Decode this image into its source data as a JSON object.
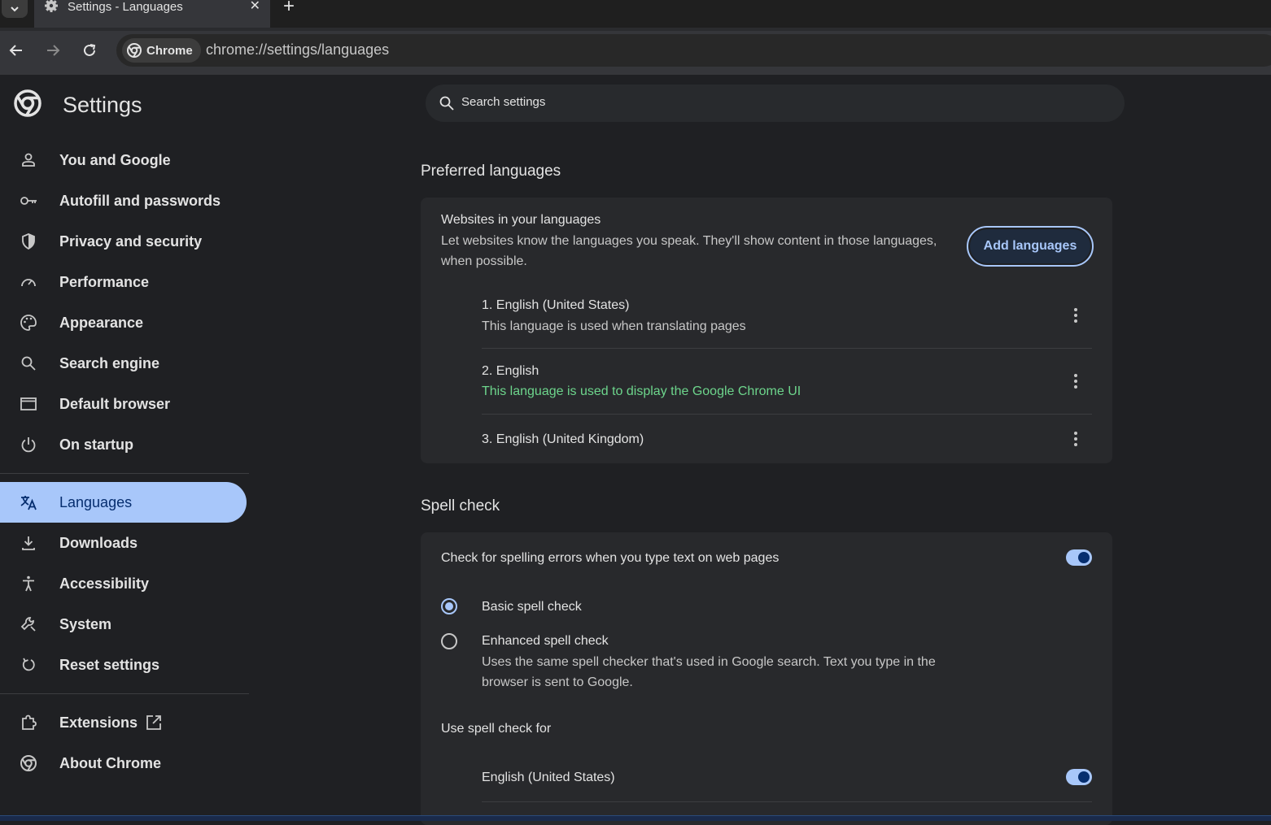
{
  "tab": {
    "title": "Settings - Languages",
    "close": "✕",
    "new_tab": "+"
  },
  "toolbar": {
    "chip_label": "Chrome",
    "url": "chrome://settings/languages"
  },
  "sidebar": {
    "title": "Settings",
    "items": [
      {
        "label": "You and Google",
        "icon": "person-icon"
      },
      {
        "label": "Autofill and passwords",
        "icon": "key-icon"
      },
      {
        "label": "Privacy and security",
        "icon": "shield-icon"
      },
      {
        "label": "Performance",
        "icon": "speedometer-icon"
      },
      {
        "label": "Appearance",
        "icon": "palette-icon"
      },
      {
        "label": "Search engine",
        "icon": "search-icon"
      },
      {
        "label": "Default browser",
        "icon": "browser-window-icon"
      },
      {
        "label": "On startup",
        "icon": "power-icon"
      },
      {
        "label": "Languages",
        "icon": "translate-icon",
        "active": true
      },
      {
        "label": "Downloads",
        "icon": "download-icon"
      },
      {
        "label": "Accessibility",
        "icon": "accessibility-icon"
      },
      {
        "label": "System",
        "icon": "wrench-icon"
      },
      {
        "label": "Reset settings",
        "icon": "reset-icon"
      },
      {
        "label": "Extensions",
        "icon": "puzzle-icon"
      },
      {
        "label": "About Chrome",
        "icon": "chrome-icon"
      }
    ]
  },
  "search": {
    "placeholder": "Search settings"
  },
  "preferred": {
    "section_title": "Preferred languages",
    "heading": "Websites in your languages",
    "description_line1": "Let websites know the languages you speak. They'll show content in those languages,",
    "description_line2": "when possible.",
    "add_button": "Add languages",
    "languages": [
      {
        "name": "1. English (United States)",
        "note": "This language is used when translating pages"
      },
      {
        "name": "2. English",
        "note": "This language is used to display the Google Chrome UI"
      },
      {
        "name": "3. English (United Kingdom)",
        "note": ""
      }
    ]
  },
  "spell": {
    "section_title": "Spell check",
    "toggle_label": "Check for spelling errors when you type text on web pages",
    "toggle_on": true,
    "basic_label": "Basic spell check",
    "enhanced_label": "Enhanced spell check",
    "enhanced_desc_line1": "Uses the same spell checker that's used in Google search. Text you type in the",
    "enhanced_desc_line2": "browser is sent to Google.",
    "use_for_label": "Use spell check for",
    "languages": [
      {
        "name": "English (United States)",
        "enabled": true
      }
    ]
  },
  "colors": {
    "accent": "#a8c7fa",
    "accent_dark": "#062e6f",
    "green": "#6dd58c",
    "background": "#1f2023",
    "card": "#28292c"
  }
}
